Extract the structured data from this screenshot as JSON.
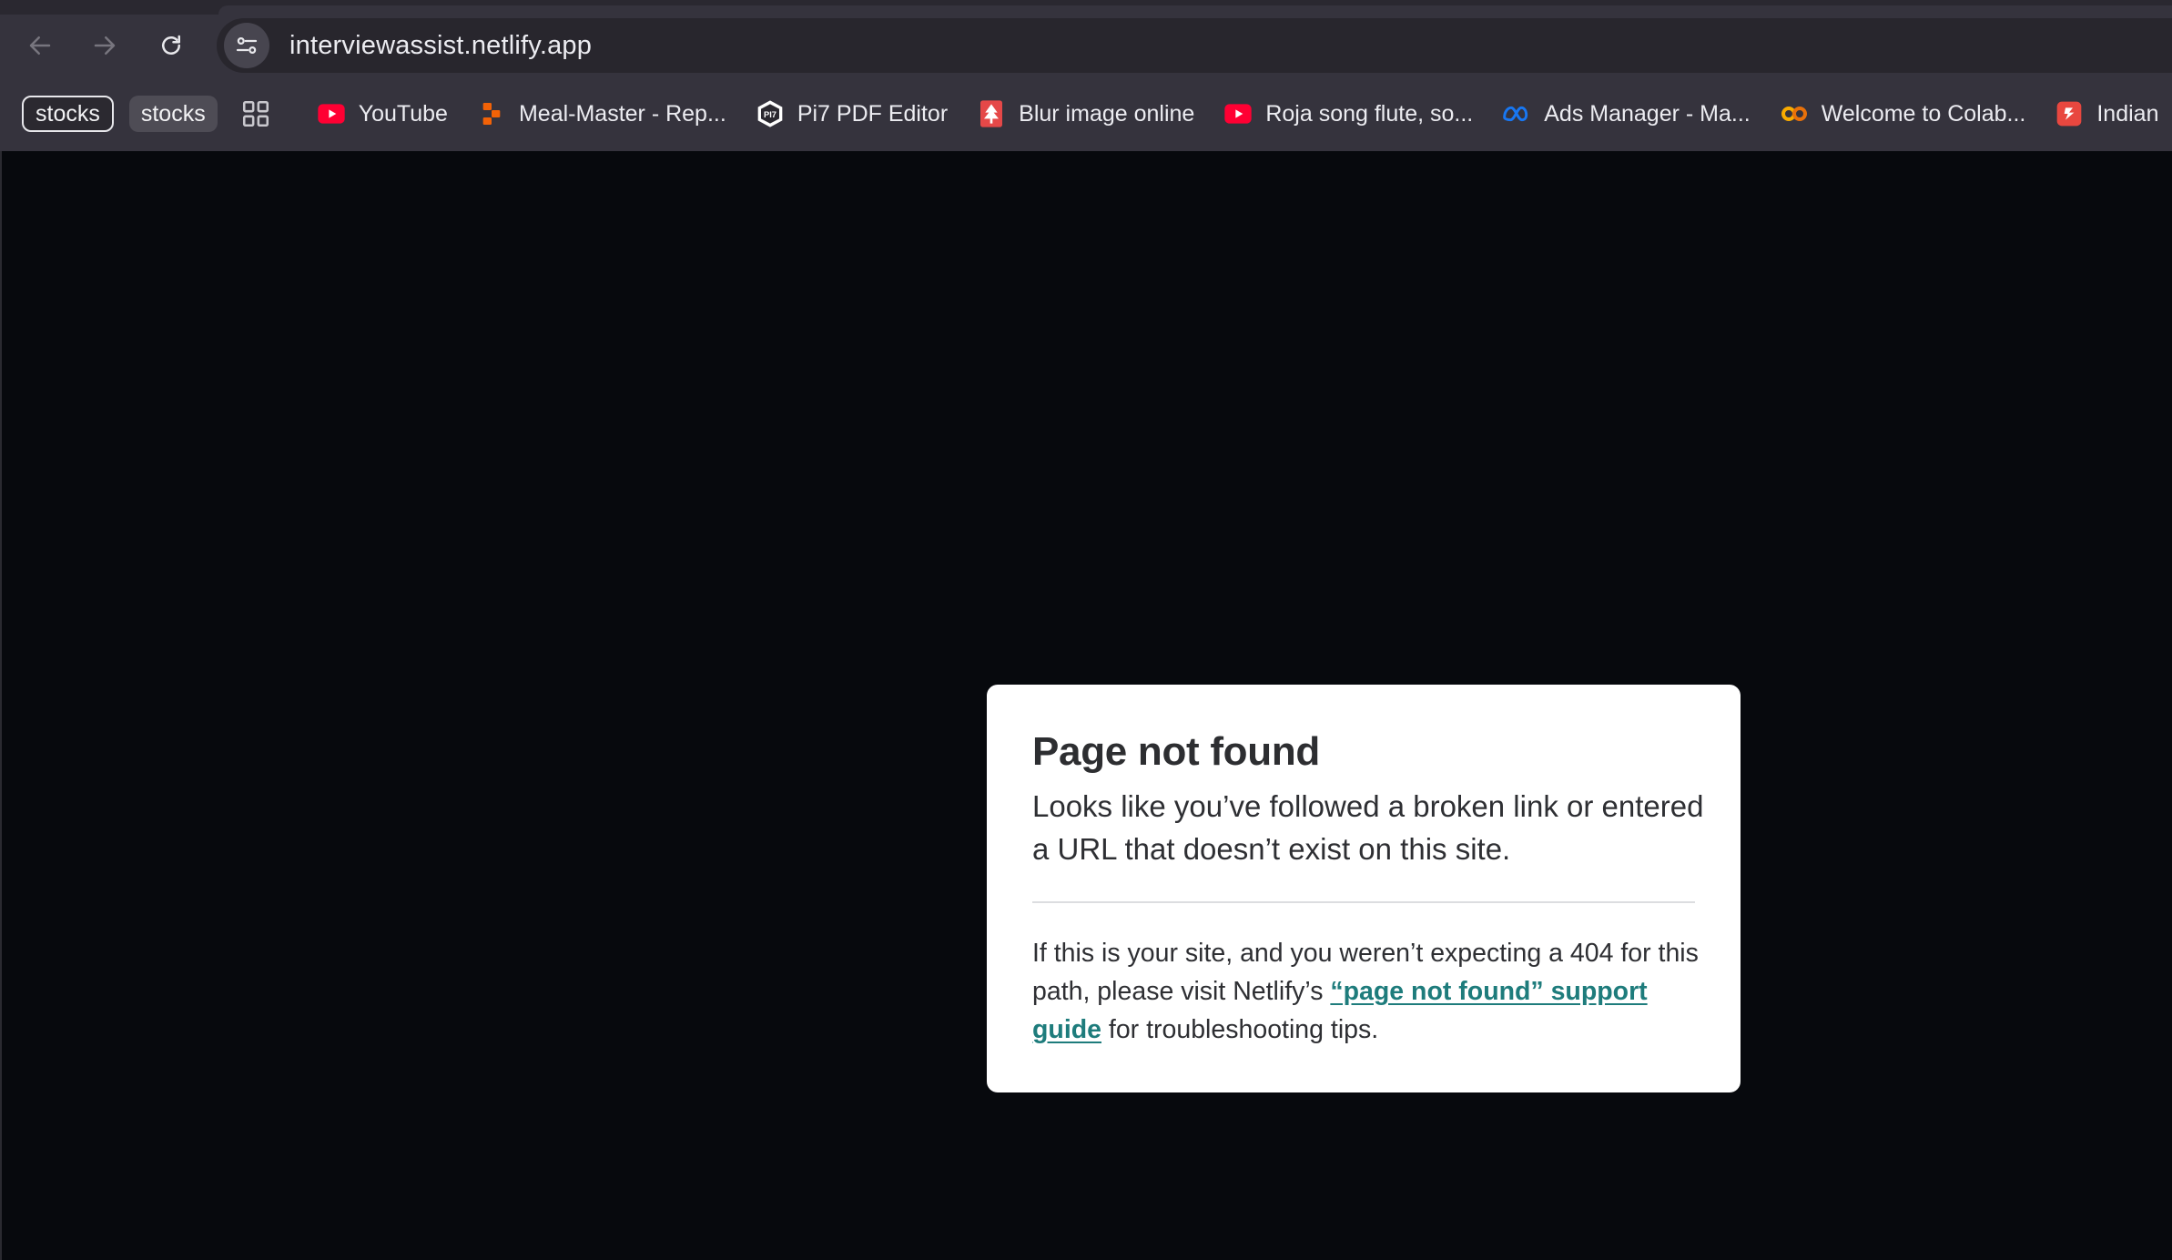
{
  "browser": {
    "url": "interviewassist.netlify.app",
    "nav": {
      "back_icon": "arrow-left-icon",
      "forward_icon": "arrow-right-icon",
      "reload_icon": "reload-icon",
      "site_info_icon": "tune-icon"
    }
  },
  "bookmarks": {
    "chips": [
      {
        "label": "stocks",
        "style": "outlined"
      },
      {
        "label": "stocks",
        "style": "filled"
      }
    ],
    "apps_icon": "apps-grid-icon",
    "items": [
      {
        "label": "YouTube",
        "icon": "youtube-icon",
        "color": "#ff0033"
      },
      {
        "label": "Meal-Master - Rep...",
        "icon": "replit-icon",
        "color": "#f26207"
      },
      {
        "label": "Pi7 PDF Editor",
        "icon": "pi7-icon",
        "color": "#ffffff"
      },
      {
        "label": "Blur image online",
        "icon": "tree-icon",
        "color": "#e54848"
      },
      {
        "label": "Roja song flute, so...",
        "icon": "youtube-icon",
        "color": "#ff0033"
      },
      {
        "label": "Ads Manager - Ma...",
        "icon": "meta-icon",
        "color": "#1877f2"
      },
      {
        "label": "Welcome to Colab...",
        "icon": "colab-icon",
        "color": "#f9ab00"
      },
      {
        "label": "Indian",
        "icon": "indian-icon",
        "color": "#e8473f"
      }
    ]
  },
  "page": {
    "title": "Page not found",
    "lead": "Looks like you’ve followed a broken link or entered a URL that doesn’t exist on this site.",
    "help_before": "If this is your site, and you weren’t expecting a 404 for this path, please visit Netlify’s ",
    "help_link": "“page not found” support guide",
    "help_after": " for troubleshooting tips.",
    "link_color": "#1e7c7c"
  }
}
